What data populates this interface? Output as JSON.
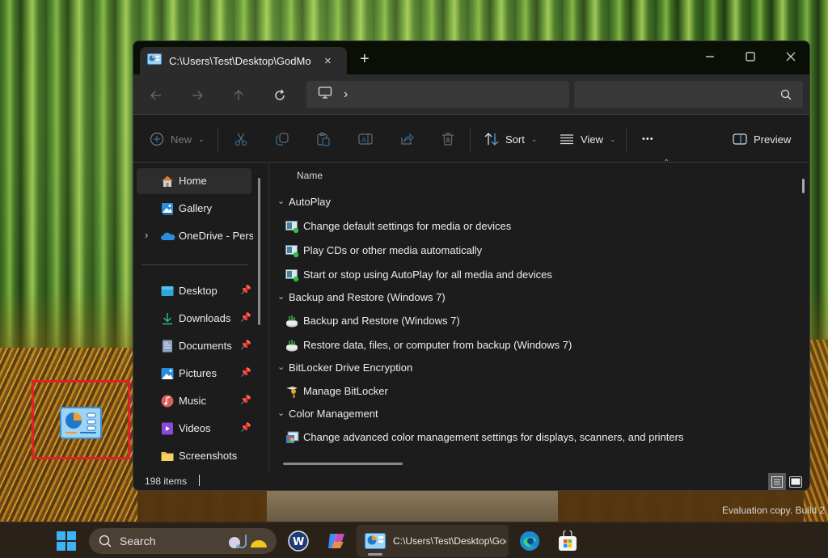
{
  "window": {
    "tab_title": "C:\\Users\\Test\\Desktop\\GodMode",
    "tab_close": "×",
    "new_tab": "+",
    "search_placeholder": ""
  },
  "toolbar": {
    "new_label": "New",
    "sort_label": "Sort",
    "view_label": "View",
    "more_label": "•••",
    "preview_label": "Preview"
  },
  "sidebar": {
    "items": [
      {
        "label": "Home",
        "icon": "home-icon",
        "pinned": false
      },
      {
        "label": "Gallery",
        "icon": "gallery-icon",
        "pinned": false
      },
      {
        "label": "OneDrive - Personal",
        "icon": "onedrive-icon",
        "pinned": false
      },
      {
        "label": "Desktop",
        "icon": "desktop-folder-icon",
        "pinned": true
      },
      {
        "label": "Downloads",
        "icon": "download-icon",
        "pinned": true
      },
      {
        "label": "Documents",
        "icon": "documents-icon",
        "pinned": true
      },
      {
        "label": "Pictures",
        "icon": "pictures-icon",
        "pinned": true
      },
      {
        "label": "Music",
        "icon": "music-icon",
        "pinned": true
      },
      {
        "label": "Videos",
        "icon": "videos-icon",
        "pinned": true
      },
      {
        "label": "Screenshots",
        "icon": "folder-icon",
        "pinned": false
      }
    ]
  },
  "content": {
    "column_name": "Name",
    "groups": [
      {
        "label": "AutoPlay",
        "items": [
          "Change default settings for media or devices",
          "Play CDs or other media automatically",
          "Start or stop using AutoPlay for all media and devices"
        ]
      },
      {
        "label": "Backup and Restore (Windows 7)",
        "items": [
          "Backup and Restore (Windows 7)",
          "Restore data, files, or computer from backup (Windows 7)"
        ]
      },
      {
        "label": "BitLocker Drive Encryption",
        "items": [
          "Manage BitLocker"
        ]
      },
      {
        "label": "Color Management",
        "items": [
          "Change advanced color management settings for displays, scanners, and printers"
        ]
      }
    ]
  },
  "status": {
    "item_count": "198 items"
  },
  "desktop": {
    "watermark": "Evaluation copy. Build 2"
  },
  "taskbar": {
    "search_label": "Search",
    "explorer_label": "C:\\Users\\Test\\Desktop\\GodMode"
  }
}
